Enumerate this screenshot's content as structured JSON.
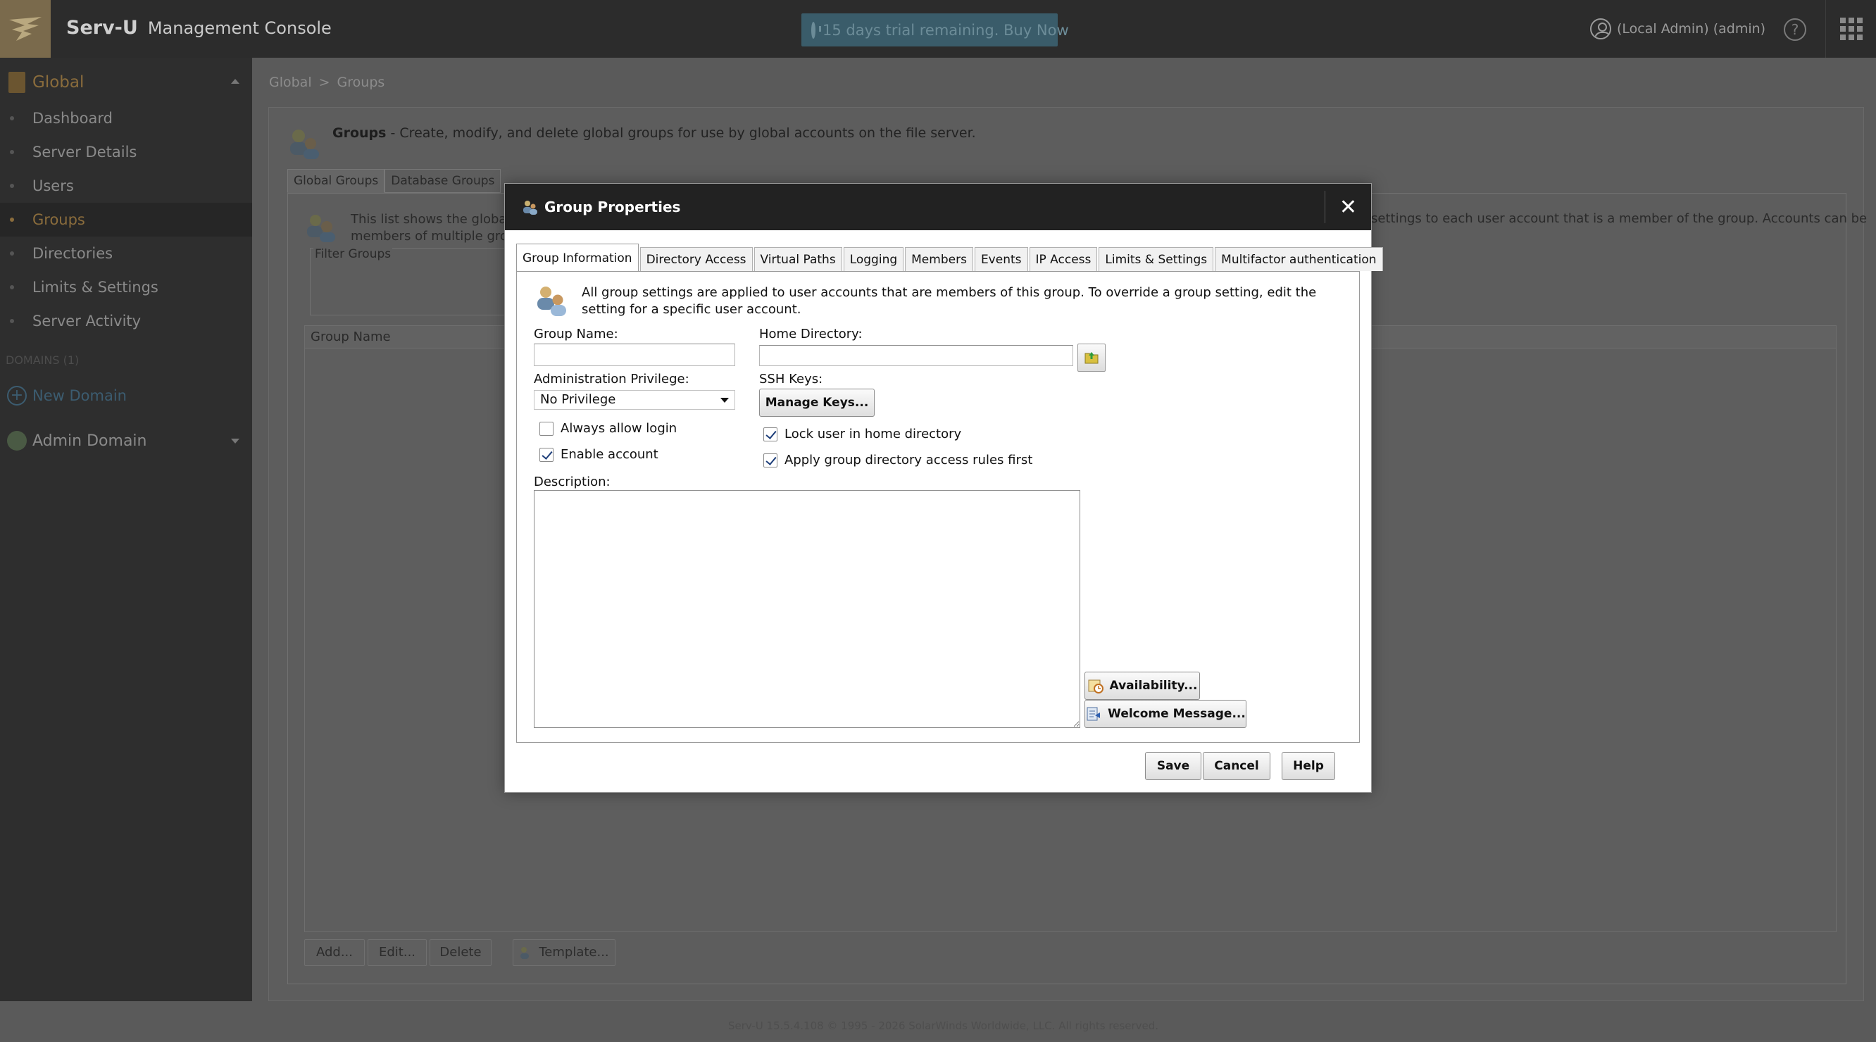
{
  "app": {
    "name": "Serv-U",
    "subtitle": "Management Console",
    "trial_banner": "15 days trial remaining. Buy Now",
    "user": "(Local Admin) (admin)",
    "help_glyph": "?",
    "brand_color": "#7a6a4c"
  },
  "sidebar": {
    "global_label": "Global",
    "items": [
      {
        "label": "Dashboard",
        "active": false
      },
      {
        "label": "Server Details",
        "active": false
      },
      {
        "label": "Users",
        "active": false
      },
      {
        "label": "Groups",
        "active": true
      },
      {
        "label": "Directories",
        "active": false
      },
      {
        "label": "Limits & Settings",
        "active": false
      },
      {
        "label": "Server Activity",
        "active": false
      }
    ],
    "domains_header": "DOMAINS (1)",
    "new_domain": "New Domain",
    "admin_domain": "Admin Domain"
  },
  "breadcrumb": {
    "root": "Global",
    "separator": ">",
    "current": "Groups"
  },
  "page": {
    "title": "Groups",
    "description": " - Create, modify, and delete global groups for use by global accounts on the file server.",
    "tabs": [
      "Global Groups",
      "Database Groups"
    ],
    "info_left": "This list shows the global g",
    "info_left_2": "members of multiple grou",
    "info_right": "settings to each user account that is a member of the group. Accounts can be",
    "filter_label": "Filter Groups",
    "list_header": "Group Name",
    "buttons": {
      "add": "Add...",
      "edit": "Edit...",
      "delete": "Delete",
      "template": "Template..."
    },
    "footer": "Serv-U 15.5.4.108 © 1995 - 2026 SolarWinds Worldwide, LLC. All rights reserved."
  },
  "dialog": {
    "title": "Group Properties",
    "close_glyph": "✕",
    "tabs": [
      {
        "label": "Group Information",
        "active": true
      },
      {
        "label": "Directory Access",
        "active": false
      },
      {
        "label": "Virtual Paths",
        "active": false
      },
      {
        "label": "Logging",
        "active": false
      },
      {
        "label": "Members",
        "active": false
      },
      {
        "label": "Events",
        "active": false
      },
      {
        "label": "IP Access",
        "active": false
      },
      {
        "label": "Limits & Settings",
        "active": false
      },
      {
        "label": "Multifactor authentication",
        "active": false
      }
    ],
    "info": "All group settings are applied to user accounts that are members of this group. To override a group setting, edit the setting for a specific user account.",
    "group_name_label": "Group Name:",
    "group_name_value": "",
    "home_dir_label": "Home Directory:",
    "home_dir_value": "",
    "admin_priv_label": "Administration Privilege:",
    "admin_priv_value": "No Privilege",
    "ssh_keys_label": "SSH Keys:",
    "manage_keys": "Manage Keys...",
    "always_allow_login": {
      "label": "Always allow login",
      "checked": false
    },
    "enable_account": {
      "label": "Enable account",
      "checked": true
    },
    "lock_home": {
      "label": "Lock user in home directory",
      "checked": true
    },
    "apply_rules": {
      "label": "Apply group directory access rules first",
      "checked": true
    },
    "description_label": "Description:",
    "description_value": "",
    "availability": "Availability...",
    "welcome_message": "Welcome Message...",
    "save": "Save",
    "cancel": "Cancel",
    "help": "Help"
  }
}
